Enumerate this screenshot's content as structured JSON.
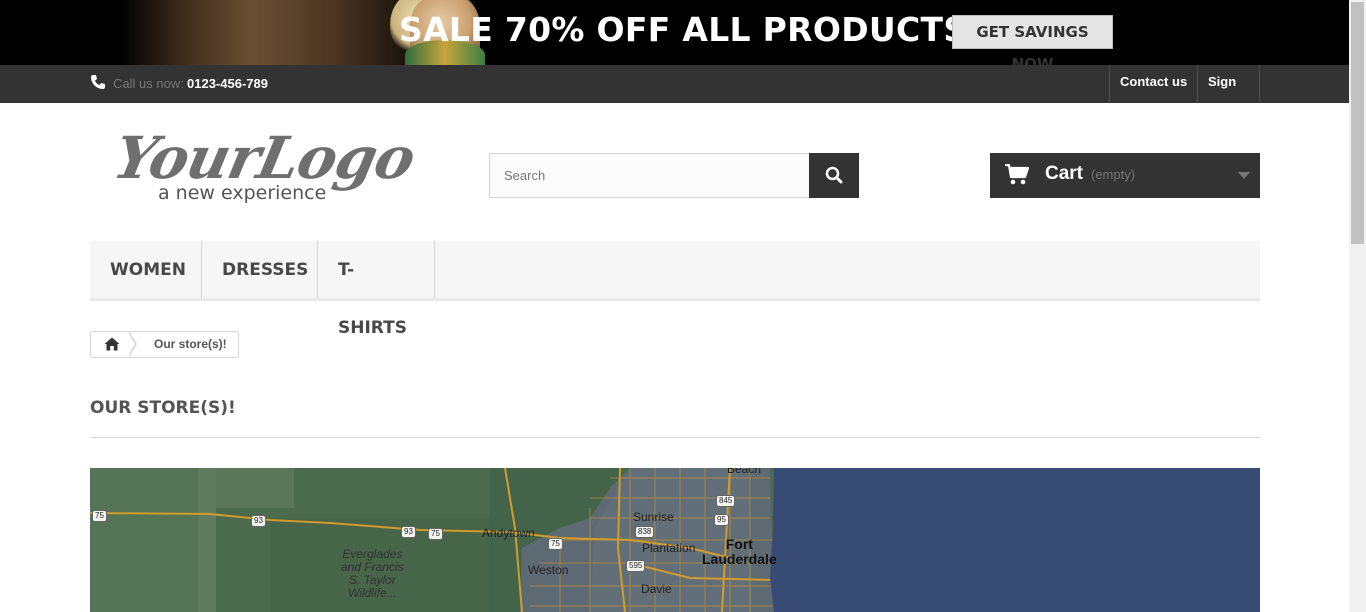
{
  "banner": {
    "text": "SALE 70% OFF ALL PRODUCTS",
    "button_label": "GET SAVINGS NOW"
  },
  "utility": {
    "call_label": "Call us now:",
    "phone_number": "0123-456-789",
    "contact_label": "Contact us",
    "signin_label": "Sign in"
  },
  "logo": {
    "main": "YourLogo",
    "tagline": "a new experience"
  },
  "search": {
    "placeholder": "Search",
    "value": ""
  },
  "cart": {
    "label": "Cart",
    "status": "(empty)"
  },
  "menu": {
    "items": [
      {
        "label": "Women"
      },
      {
        "label": "Dresses"
      },
      {
        "label": "T-shirts"
      }
    ]
  },
  "breadcrumb": {
    "current": "Our store(s)!"
  },
  "page": {
    "heading": "Our store(s)!"
  },
  "map": {
    "labels": {
      "everglades": "Everglades\nand Francis\nS. Taylor\nWildlife...",
      "andytown": "Andytown",
      "sunrise": "Sunrise",
      "plantation": "Plantation",
      "weston": "Weston",
      "davie": "Davie",
      "fort_lauderdale": "Fort\nLauderdale",
      "beach": "Beach"
    },
    "shields": {
      "s75_left": "75",
      "s93_a": "93",
      "s93_b": "93",
      "s75_b": "75",
      "s75_c": "75",
      "s838": "838",
      "s845": "845",
      "s95": "95",
      "s595": "595"
    },
    "colors": {
      "land": "#4b6a4e",
      "water": "#374a74",
      "urban": "#5d6a73"
    }
  },
  "icons": {
    "phone": "phone-icon",
    "search": "search-icon",
    "cart": "cart-icon",
    "home": "home-icon",
    "caret": "chevron-down-icon"
  }
}
